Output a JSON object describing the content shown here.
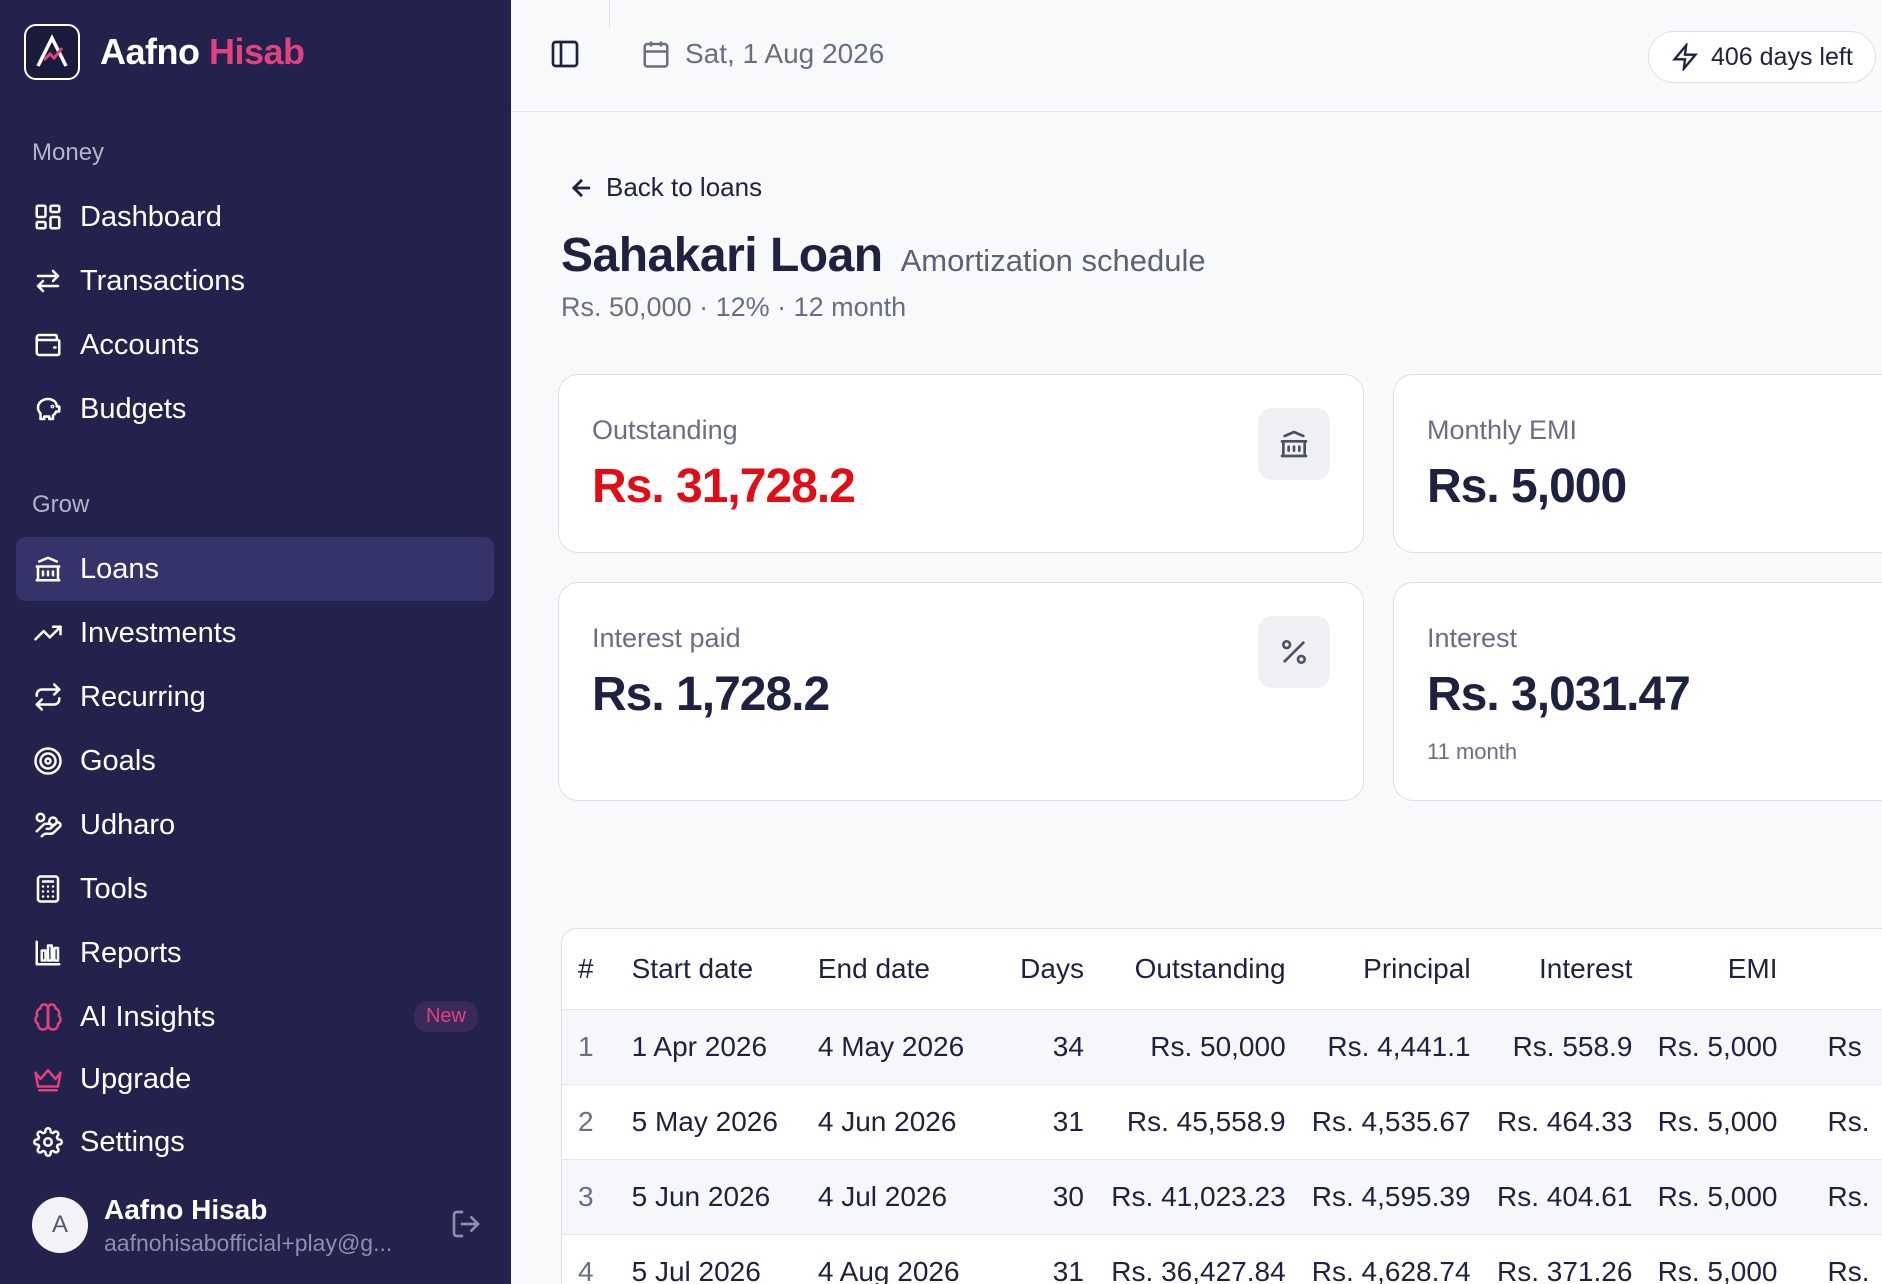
{
  "app": {
    "name_part1": "Aafno",
    "name_part2": "Hisab"
  },
  "sidebar": {
    "sections": [
      {
        "label": "Money",
        "items": [
          {
            "label": "Dashboard",
            "icon": "dashboard-icon"
          },
          {
            "label": "Transactions",
            "icon": "transactions-icon"
          },
          {
            "label": "Accounts",
            "icon": "wallet-icon"
          },
          {
            "label": "Budgets",
            "icon": "piggy-bank-icon"
          }
        ]
      },
      {
        "label": "Grow",
        "items": [
          {
            "label": "Loans",
            "icon": "bank-icon",
            "active": true
          },
          {
            "label": "Investments",
            "icon": "trending-up-icon"
          },
          {
            "label": "Recurring",
            "icon": "repeat-icon"
          },
          {
            "label": "Goals",
            "icon": "target-icon"
          },
          {
            "label": "Udharo",
            "icon": "hand-coins-icon"
          },
          {
            "label": "Tools",
            "icon": "calculator-icon"
          },
          {
            "label": "Reports",
            "icon": "bar-chart-icon"
          },
          {
            "label": "AI Insights",
            "icon": "brain-icon",
            "badge": "New"
          },
          {
            "label": "Upgrade",
            "icon": "crown-icon"
          },
          {
            "label": "Settings",
            "icon": "gear-icon"
          }
        ]
      }
    ],
    "user": {
      "avatar_initial": "A",
      "name": "Aafno Hisab",
      "email": "aafnohisabofficial+play@g..."
    }
  },
  "topbar": {
    "date": "Sat, 1 Aug 2026",
    "days_left": "406 days left"
  },
  "page": {
    "back_label": "Back to loans",
    "title": "Sahakari Loan",
    "subtitle": "Amortization schedule",
    "meta": "Rs. 50,000 · 12% · 12 month"
  },
  "cards": {
    "outstanding": {
      "label": "Outstanding",
      "value": "Rs. 31,728.2"
    },
    "monthly_emi": {
      "label": "Monthly EMI",
      "value": "Rs. 5,000"
    },
    "interest_paid": {
      "label": "Interest paid",
      "value": "Rs. 1,728.2"
    },
    "interest": {
      "label": "Interest",
      "value": "Rs. 3,031.47",
      "sub": "11 month"
    }
  },
  "table": {
    "headers": [
      "#",
      "Start date",
      "End date",
      "Days",
      "Outstanding",
      "Principal",
      "Interest",
      "EMI"
    ],
    "rows": [
      {
        "num": "1",
        "start": "1 Apr 2026",
        "end": "4 May 2026",
        "days": "34",
        "outstanding": "Rs. 50,000",
        "principal": "Rs. 4,441.1",
        "interest": "Rs. 558.9",
        "emi": "Rs. 5,000",
        "extra": "Rs"
      },
      {
        "num": "2",
        "start": "5 May 2026",
        "end": "4 Jun 2026",
        "days": "31",
        "outstanding": "Rs. 45,558.9",
        "principal": "Rs. 4,535.67",
        "interest": "Rs. 464.33",
        "emi": "Rs. 5,000",
        "extra": "Rs."
      },
      {
        "num": "3",
        "start": "5 Jun 2026",
        "end": "4 Jul 2026",
        "days": "30",
        "outstanding": "Rs. 41,023.23",
        "principal": "Rs. 4,595.39",
        "interest": "Rs. 404.61",
        "emi": "Rs. 5,000",
        "extra": "Rs."
      },
      {
        "num": "4",
        "start": "5 Jul 2026",
        "end": "4 Aug 2026",
        "days": "31",
        "outstanding": "Rs. 36,427.84",
        "principal": "Rs. 4,628.74",
        "interest": "Rs. 371.26",
        "emi": "Rs. 5,000",
        "extra": "Rs."
      }
    ]
  },
  "colors": {
    "sidebar_bg": "#22224c",
    "active_item_bg": "#34346a",
    "brand_accent": "#e0417f",
    "outstanding_red": "#e00d17"
  }
}
